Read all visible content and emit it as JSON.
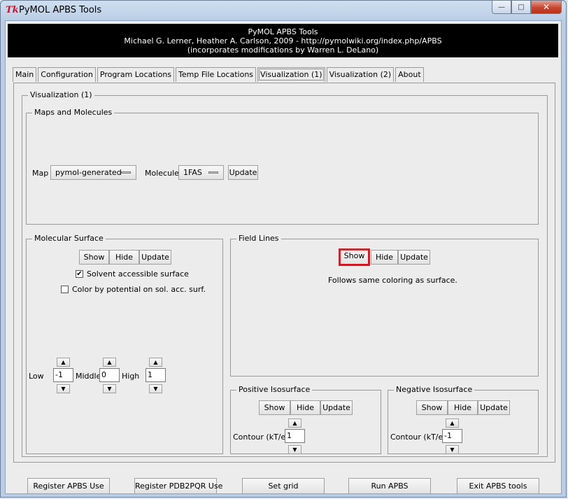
{
  "window": {
    "icon_text": "Tk",
    "title": "PyMOL APBS Tools",
    "minimize": "—",
    "maximize": "□",
    "close": "✕"
  },
  "banner": {
    "line1": "PyMOL APBS Tools",
    "line2": "Michael G. Lerner, Heather A. Carlson, 2009 - http://pymolwiki.org/index.php/APBS",
    "line3": "(incorporates modifications by Warren L. DeLano)"
  },
  "tabs": [
    {
      "label": "Main"
    },
    {
      "label": "Configuration"
    },
    {
      "label": "Program Locations"
    },
    {
      "label": "Temp File Locations"
    },
    {
      "label": "Visualization (1)"
    },
    {
      "label": "Visualization (2)"
    },
    {
      "label": "About"
    }
  ],
  "panel": {
    "title": "Visualization (1)",
    "maps": {
      "title": "Maps and Molecules",
      "map_label": "Map",
      "map_value": "pymol-generated",
      "molecule_label": "Molecule",
      "molecule_value": "1FAS",
      "update": "Update"
    },
    "molsurf": {
      "title": "Molecular Surface",
      "show": "Show",
      "hide": "Hide",
      "update": "Update",
      "sas_label": "Solvent accessible surface",
      "sas_checked": true,
      "color_label": "Color by potential on sol. acc. surf.",
      "color_checked": false,
      "low_label": "Low",
      "low_value": "-1",
      "middle_label": "Middle",
      "middle_value": "0",
      "high_label": "High",
      "high_value": "1"
    },
    "fieldlines": {
      "title": "Field Lines",
      "show": "Show",
      "hide": "Hide",
      "update": "Update",
      "note": "Follows same coloring as surface."
    },
    "posiso": {
      "title": "Positive Isosurface",
      "show": "Show",
      "hide": "Hide",
      "update": "Update",
      "contour_label": "Contour (kT/e)",
      "contour_value": "1"
    },
    "negiso": {
      "title": "Negative Isosurface",
      "show": "Show",
      "hide": "Hide",
      "update": "Update",
      "contour_label": "Contour (kT/e)",
      "contour_value": "-1"
    }
  },
  "bottom": {
    "register_apbs": "Register APBS Use",
    "register_pdb2pqr": "Register PDB2PQR Use",
    "set_grid": "Set grid",
    "run_apbs": "Run APBS",
    "exit": "Exit APBS tools"
  },
  "icons": {
    "up_arrow": "▲",
    "down_arrow": "▼",
    "check": "✔"
  },
  "colors": {
    "highlight": "#e0101a",
    "banner_bg": "#000000"
  }
}
